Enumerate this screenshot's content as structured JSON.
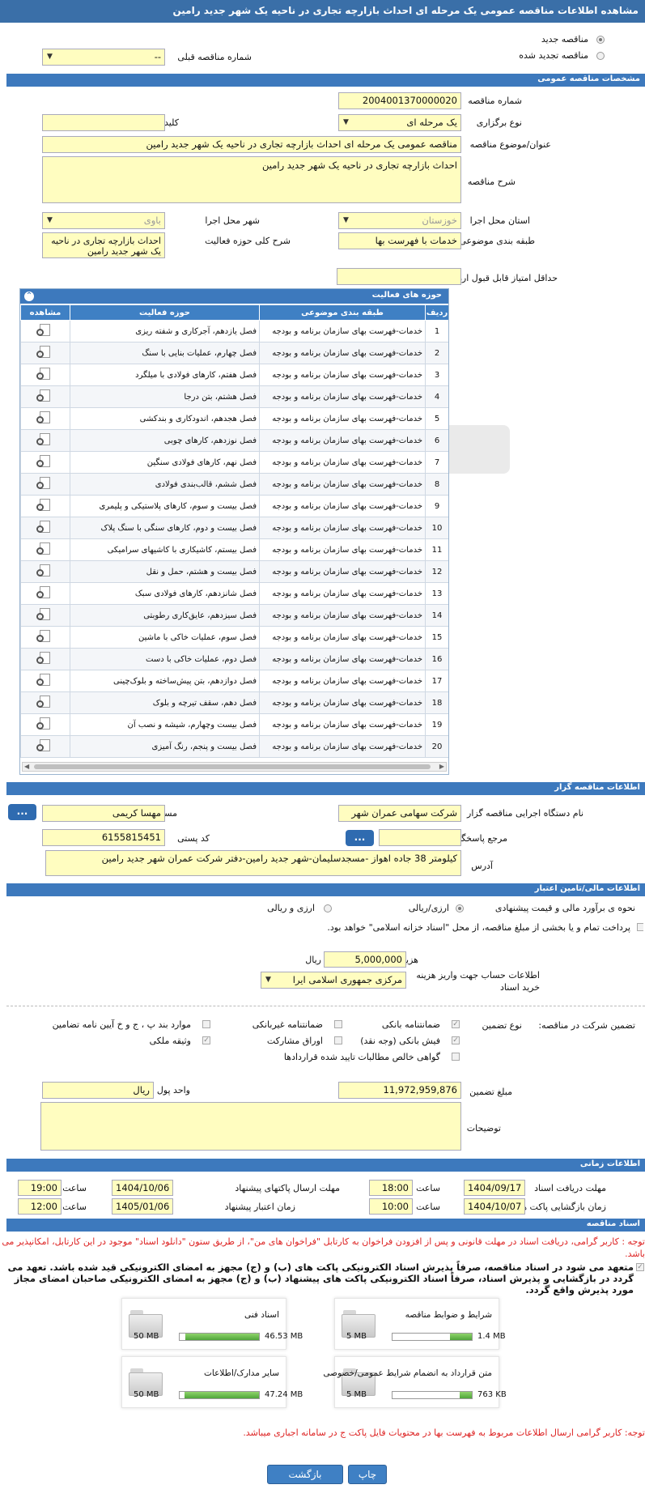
{
  "page_title": "مشاهده اطلاعات مناقصه عمومی یک مرحله ای احداث بازارچه تجاری در ناحیه یک شهر جدید رامین",
  "header": {
    "new_tender_label": "مناقصه جدید",
    "renewed_tender_label": "مناقصه تجدید شده",
    "prev_tender_label": "شماره مناقصه قبلی",
    "prev_tender_value": "--"
  },
  "general": {
    "section_title": "مشخصات مناقصه عمومی",
    "tender_no_label": "شماره مناقصه",
    "tender_no": "2004001370000020",
    "type_label": "نوع برگزاری",
    "type_value": "یک مرحله ای",
    "keyword_label": "کلید واژه",
    "keyword_value": "",
    "subject_label": "عنوان/موضوع مناقصه",
    "subject_value": "مناقصه عمومی یک مرحله ای احداث بازارچه تجاری در ناحیه یک شهر جدید رامین",
    "desc_label": "شرح مناقصه",
    "desc_value": "احداث بازارچه تجاری در ناحیه یک شهر جدید رامین",
    "province_label": "استان محل اجرا",
    "province_value": "خوزستان",
    "city_label": "شهر محل اجرا",
    "city_value": "باوی",
    "category_label": "طبقه بندی موضوعی",
    "category_value": "خدمات با فهرست بها",
    "scope_label": "شرح کلی حوزه فعالیت",
    "scope_value": "احداث بازارچه تجاری در ناحیه یک شهر جدید رامین",
    "min_score_label": "حداقل امتیاز قابل قبول ارزیابی فنی/بازرگانی",
    "min_score_value": ""
  },
  "activities": {
    "title": "حوزه های فعالیت",
    "columns": [
      "ردیف",
      "طبقه بندی موضوعی",
      "حوزه فعالیت",
      "مشاهده"
    ],
    "rows": [
      {
        "no": "1",
        "cat": "خدمات-فهرست بهای سازمان برنامه و بودجه",
        "act": "فصل یازدهم، آجرکاری و شفته ریزی"
      },
      {
        "no": "2",
        "cat": "خدمات-فهرست بهای سازمان برنامه و بودجه",
        "act": "فصل چهارم، عملیات بنایی با سنگ"
      },
      {
        "no": "3",
        "cat": "خدمات-فهرست بهای سازمان برنامه و بودجه",
        "act": "فصل هفتم، کارهای فولادی با میلگرد"
      },
      {
        "no": "4",
        "cat": "خدمات-فهرست بهای سازمان برنامه و بودجه",
        "act": "فصل هشتم، بتن درجا"
      },
      {
        "no": "5",
        "cat": "خدمات-فهرست بهای سازمان برنامه و بودجه",
        "act": "فصل هجدهم، اندودکاری و بندکشی"
      },
      {
        "no": "6",
        "cat": "خدمات-فهرست بهای سازمان برنامه و بودجه",
        "act": "فصل نوزدهم، کارهای چوبی"
      },
      {
        "no": "7",
        "cat": "خدمات-فهرست بهای سازمان برنامه و بودجه",
        "act": "فصل نهم، کارهای فولادی سنگین"
      },
      {
        "no": "8",
        "cat": "خدمات-فهرست بهای سازمان برنامه و بودجه",
        "act": "فصل ششم، قالب‌بندی فولادی"
      },
      {
        "no": "9",
        "cat": "خدمات-فهرست بهای سازمان برنامه و بودجه",
        "act": "فصل بیست و سوم، کارهای پلاستیکی و پلیمری"
      },
      {
        "no": "10",
        "cat": "خدمات-فهرست بهای سازمان برنامه و بودجه",
        "act": "فصل بیست و دوم، کارهای سنگی با سنگ پلاک"
      },
      {
        "no": "11",
        "cat": "خدمات-فهرست بهای سازمان برنامه و بودجه",
        "act": "فصل بیستم، کاشیکاری با کاشیهای سرامیکی"
      },
      {
        "no": "12",
        "cat": "خدمات-فهرست بهای سازمان برنامه و بودجه",
        "act": "فصل بیست و هشتم، حمل و نقل"
      },
      {
        "no": "13",
        "cat": "خدمات-فهرست بهای سازمان برنامه و بودجه",
        "act": "فصل شانزدهم، کارهای فولادی سبک"
      },
      {
        "no": "14",
        "cat": "خدمات-فهرست بهای سازمان برنامه و بودجه",
        "act": "فصل سیزدهم، عایق‌کاری رطوبتی"
      },
      {
        "no": "15",
        "cat": "خدمات-فهرست بهای سازمان برنامه و بودجه",
        "act": "فصل سوم، عملیات خاکی با ماشین"
      },
      {
        "no": "16",
        "cat": "خدمات-فهرست بهای سازمان برنامه و بودجه",
        "act": "فصل دوم، عملیات خاکی با دست"
      },
      {
        "no": "17",
        "cat": "خدمات-فهرست بهای سازمان برنامه و بودجه",
        "act": "فصل دوازدهم، بتن پیش‌ساخته و بلوک‌چینی"
      },
      {
        "no": "18",
        "cat": "خدمات-فهرست بهای سازمان برنامه و بودجه",
        "act": "فصل دهم، سقف تیرچه و بلوک"
      },
      {
        "no": "19",
        "cat": "خدمات-فهرست بهای سازمان برنامه و بودجه",
        "act": "فصل بیست وچهارم، شیشه و نصب آن"
      },
      {
        "no": "20",
        "cat": "خدمات-فهرست بهای سازمان برنامه و بودجه",
        "act": "فصل بیست و پنجم، رنگ آمیزی"
      }
    ]
  },
  "organizer": {
    "section_title": "اطلاعات مناقصه گزار",
    "org_label": "نام دستگاه اجرایی مناقصه گزار",
    "org_value": "شرکت سهامی عمران شهر",
    "registrar_label": "مسئول ثبت مناقصه",
    "registrar_value": "مهسا کریمی",
    "ref_label": "مرجع پاسخگویی",
    "ref_value": "",
    "postal_label": "کد پستی",
    "postal_value": "6155815451",
    "address_label": "آدرس",
    "address_value": "کیلومتر 38 جاده اهواز -مسجدسلیمان-شهر جدید رامین-دفتر شرکت عمران شهر جدید رامین",
    "dots": "..."
  },
  "finance": {
    "section_title": "اطلاعات مالی/تامین اعتبار",
    "estimate_label": "نحوه ی برآورد مالی و قیمت پیشنهادی",
    "opt_rial": "ارزی/ریالی",
    "opt_both": "ارزی و ریالی",
    "payment_text": "پرداخت تمام و یا بخشی از مبلغ مناقصه، از محل \"اسناد خزانه اسلامی\" خواهد بود.",
    "doc_fee_label": "هزینه خرید اسناد",
    "doc_fee_value": "5,000,000",
    "doc_fee_unit": "ریال",
    "account_label": "اطلاعات حساب جهت واریز هزینه خرید اسناد",
    "account_value": "مرکزی جمهوری اسلامی ایرا"
  },
  "guarantee": {
    "label": "تضمین شرکت در مناقصه:",
    "type_label": "نوع تضمین",
    "options": {
      "bank": "ضمانتنامه بانکی",
      "nonbank": "ضمانتنامه غیربانکی",
      "items": "موارد بند پ ، ج و خ آیین نامه تضامین",
      "cash": "فیش بانکی (وجه نقد)",
      "shares": "اوراق مشارکت",
      "property": "وثیقه ملکی",
      "claims": "گواهی خالص مطالبات تایید شده قراردادها"
    },
    "amount_label": "مبلغ تضمین",
    "amount_value": "11,972,959,876",
    "currency_label": "واحد پول",
    "currency_value": "ریال",
    "notes_label": "توضیحات",
    "notes_value": ""
  },
  "timing": {
    "section_title": "اطلاعات زمانی",
    "receive_label": "مهلت دریافت اسناد",
    "receive_date": "1404/09/17",
    "receive_time": "18:00",
    "submit_label": "مهلت ارسال پاکتهای پیشنهاد",
    "submit_date": "1404/10/06",
    "submit_time": "19:00",
    "open_label": "زمان بازگشایی پاکت ها",
    "open_date": "1404/10/07",
    "open_time": "10:00",
    "validity_label": "زمان اعتبار پیشنهاد",
    "validity_date": "1405/01/06",
    "validity_time": "12:00",
    "time_label": "ساعت"
  },
  "documents": {
    "section_title": "اسناد مناقصه",
    "note1": "توجه : کاربر گرامی، دریافت اسناد در مهلت قانونی و پس از افزودن فراخوان به کارتابل \"فراخوان های من\"، از طریق ستون \"دانلود اسناد\" موجود در این کارتابل، امکانپذیر می باشد.",
    "note2": "متعهد می شود در اسناد مناقصه، صرفاً پذیرش اسناد الکترونیکی پاکت های (ب) و (ج) مجهز به امضای الکترونیکی قید شده باشد. تعهد می گردد در بازگشایی و پذیرش اسناد، صرفاً اسناد الکترونیکی پاکت های پیشنهاد (ب) و (ج) مجهز به امضای الکترونیکی صاحبان امضای مجاز مورد پذیرش واقع گردد.",
    "files": [
      {
        "name": "شرایط و ضوابط مناقصه",
        "used": "1.4 MB",
        "max": "5 MB",
        "fraction": 0.28
      },
      {
        "name": "اسناد فنی",
        "used": "46.53 MB",
        "max": "50 MB",
        "fraction": 0.93
      },
      {
        "name": "متن قرارداد به انضمام شرایط عمومی/خصوصی",
        "used": "763 KB",
        "max": "5 MB",
        "fraction": 0.15
      },
      {
        "name": "سایر مدارک/اطلاعات",
        "used": "47.24 MB",
        "max": "50 MB",
        "fraction": 0.94
      }
    ],
    "note3": "توجه: کاربر گرامی ارسال اطلاعات مربوط به فهرست بها در محتویات فایل پاکت ج در سامانه اجباری میباشد."
  },
  "buttons": {
    "print": "چاپ",
    "back": "بازگشت"
  }
}
